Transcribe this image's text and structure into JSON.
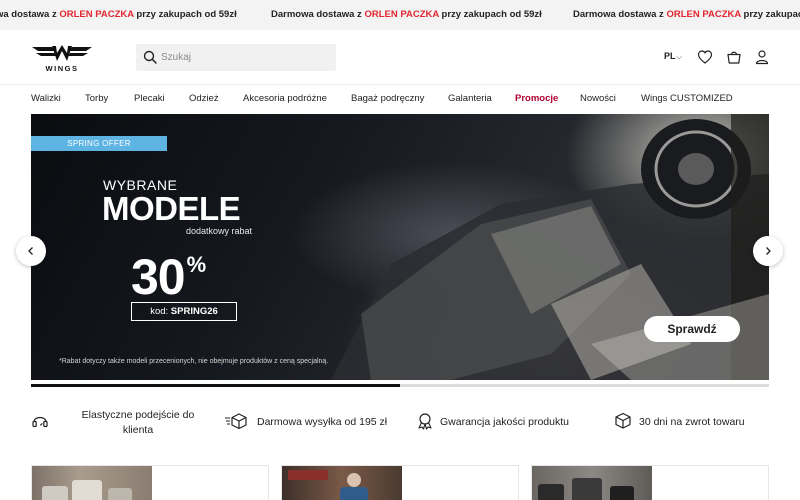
{
  "promo_bar": {
    "items": [
      {
        "prefix": "wa dostawa z ",
        "highlight": "ORLEN PACZKA",
        "suffix": " przy zakupach od 59zł"
      },
      {
        "prefix": "Darmowa dostawa z ",
        "highlight": "ORLEN PACZKA",
        "suffix": " przy zakupach od 59zł"
      },
      {
        "prefix": "Darmowa dostawa z ",
        "highlight": "ORLEN PACZKA",
        "suffix": " przy zakupach od"
      }
    ],
    "highlight_color": "#e3262f"
  },
  "header": {
    "logo_text": "WINGS",
    "search_placeholder": "Szukaj",
    "language": "PL",
    "icons": [
      "search-icon",
      "heart-icon",
      "cart-icon",
      "user-icon"
    ]
  },
  "nav": {
    "items": [
      "Walizki",
      "Torby",
      "Plecaki",
      "Odzież",
      "Akcesoria podróżne",
      "Bagaż podręczny",
      "Galanteria",
      "Promocje",
      "Nowości",
      "Wings CUSTOMIZED"
    ],
    "active_color": "#b00032"
  },
  "hero": {
    "badge": "SPRING OFFER",
    "line1": "WYBRANE",
    "line2": "MODELE",
    "line3": "dodatkowy rabat",
    "discount": "30",
    "percent_sign": "%",
    "code_label": "kod: ",
    "code_value": "SPRING26",
    "note": "*Rabat dotyczy także modeli przecenionych, nie obejmuje produktów z ceną specjalną.",
    "cta": "Sprawdź",
    "badge_color": "#5db4e3",
    "slider_progress": 0.5
  },
  "usps": [
    {
      "icon": "headset-icon",
      "line1": "Elastyczne podejście do",
      "line2": "klienta"
    },
    {
      "icon": "delivery-box-icon",
      "text": "Darmowa wysyłka od 195 zł"
    },
    {
      "icon": "quality-badge-icon",
      "text": "Gwarancja jakości produktu"
    },
    {
      "icon": "return-box-icon",
      "text": "30 dni na zwrot towaru"
    }
  ]
}
